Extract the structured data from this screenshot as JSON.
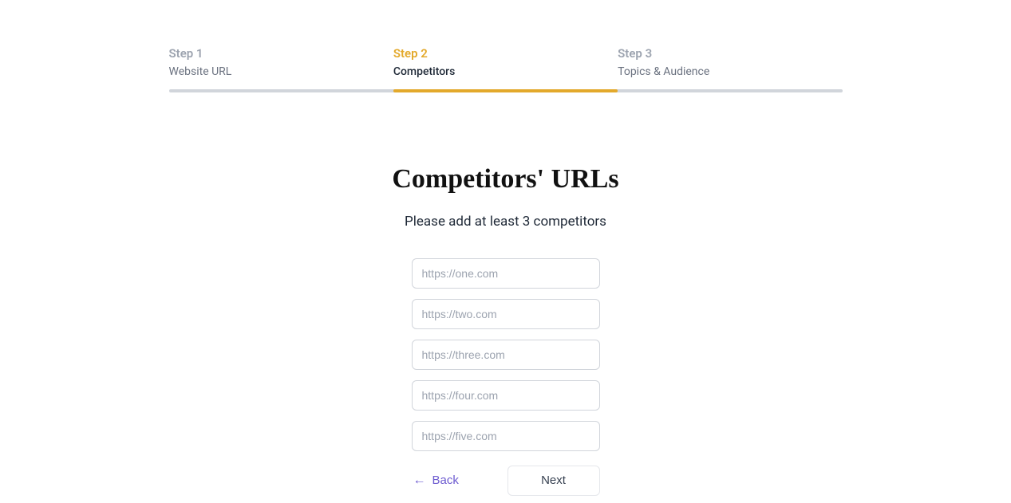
{
  "stepper": {
    "steps": [
      {
        "title": "Step 1",
        "subtitle": "Website URL"
      },
      {
        "title": "Step 2",
        "subtitle": "Competitors"
      },
      {
        "title": "Step 3",
        "subtitle": "Topics & Audience"
      }
    ]
  },
  "page": {
    "title": "Competitors' URLs",
    "subtitle": "Please add at least 3 competitors"
  },
  "inputs": [
    {
      "placeholder": "https://one.com"
    },
    {
      "placeholder": "https://two.com"
    },
    {
      "placeholder": "https://three.com"
    },
    {
      "placeholder": "https://four.com"
    },
    {
      "placeholder": "https://five.com"
    }
  ],
  "actions": {
    "back": "Back",
    "next": "Next"
  }
}
